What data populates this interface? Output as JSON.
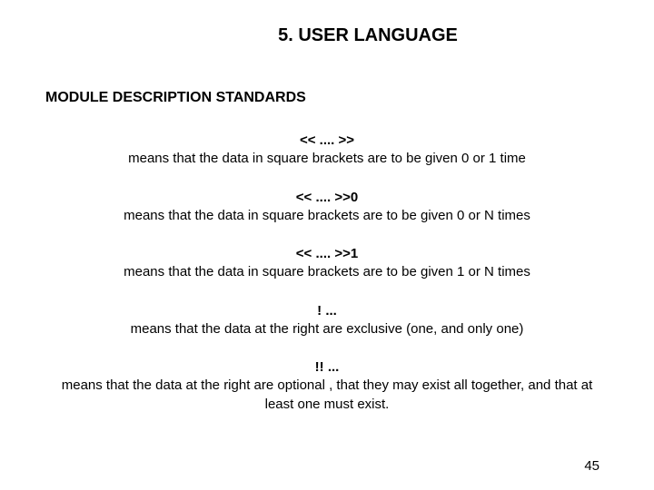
{
  "title": "5. USER LANGUAGE",
  "section_heading": "MODULE DESCRIPTION STANDARDS",
  "entries": [
    {
      "symbol": "<< .... >>",
      "desc": "means that the data in square brackets are to be given 0 or 1 time"
    },
    {
      "symbol": "<< .... >>0",
      "desc": "means that the data in square brackets are to be given 0 or N times"
    },
    {
      "symbol": "<< .... >>1",
      "desc": "means that the data in square brackets are to be given 1 or N times"
    },
    {
      "symbol": "! ...",
      "desc": "means that the data at the right are exclusive (one, and only one)"
    },
    {
      "symbol": "!! ...",
      "desc": "means that the data at the right are optional , that they may exist all together, and that at least one must exist."
    }
  ],
  "page_number": "45"
}
